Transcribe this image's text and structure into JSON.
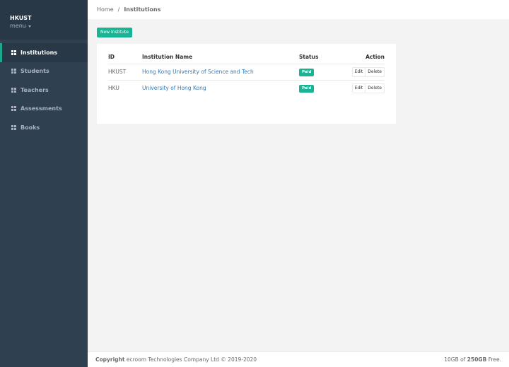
{
  "sidebar": {
    "org_name": "HKUST",
    "menu_label": "menu",
    "items": [
      {
        "label": "Institutions",
        "icon": "grid-icon",
        "active": true
      },
      {
        "label": "Students",
        "icon": "grid-icon"
      },
      {
        "label": "Teachers",
        "icon": "grid-icon"
      },
      {
        "label": "Assessments",
        "icon": "grid-icon"
      },
      {
        "label": "Books",
        "icon": "grid-icon"
      }
    ]
  },
  "breadcrumb": {
    "home": "Home",
    "separator": "/",
    "current": "Institutions"
  },
  "toolbar": {
    "new_label": "New Institute"
  },
  "table": {
    "headers": {
      "id": "ID",
      "name": "Institution Name",
      "status": "Status",
      "action": "Action"
    },
    "rows": [
      {
        "id": "HKUST",
        "name": "Hong Kong University of Science and Tech",
        "status": "Paid",
        "edit": "Edit",
        "delete": "Delete"
      },
      {
        "id": "HKU",
        "name": "University of Hong Kong",
        "status": "Paid",
        "edit": "Edit",
        "delete": "Delete"
      }
    ]
  },
  "footer": {
    "copyright_label": "Copyright",
    "copyright_text": "ecroom Technologies Company Ltd © 2019-2020",
    "storage_used": "10GB",
    "storage_of": "of",
    "storage_total": "250GB",
    "storage_suffix": "Free."
  },
  "colors": {
    "sidebar_bg": "#2f4050",
    "accent": "#1ab394",
    "link": "#337ab7"
  }
}
